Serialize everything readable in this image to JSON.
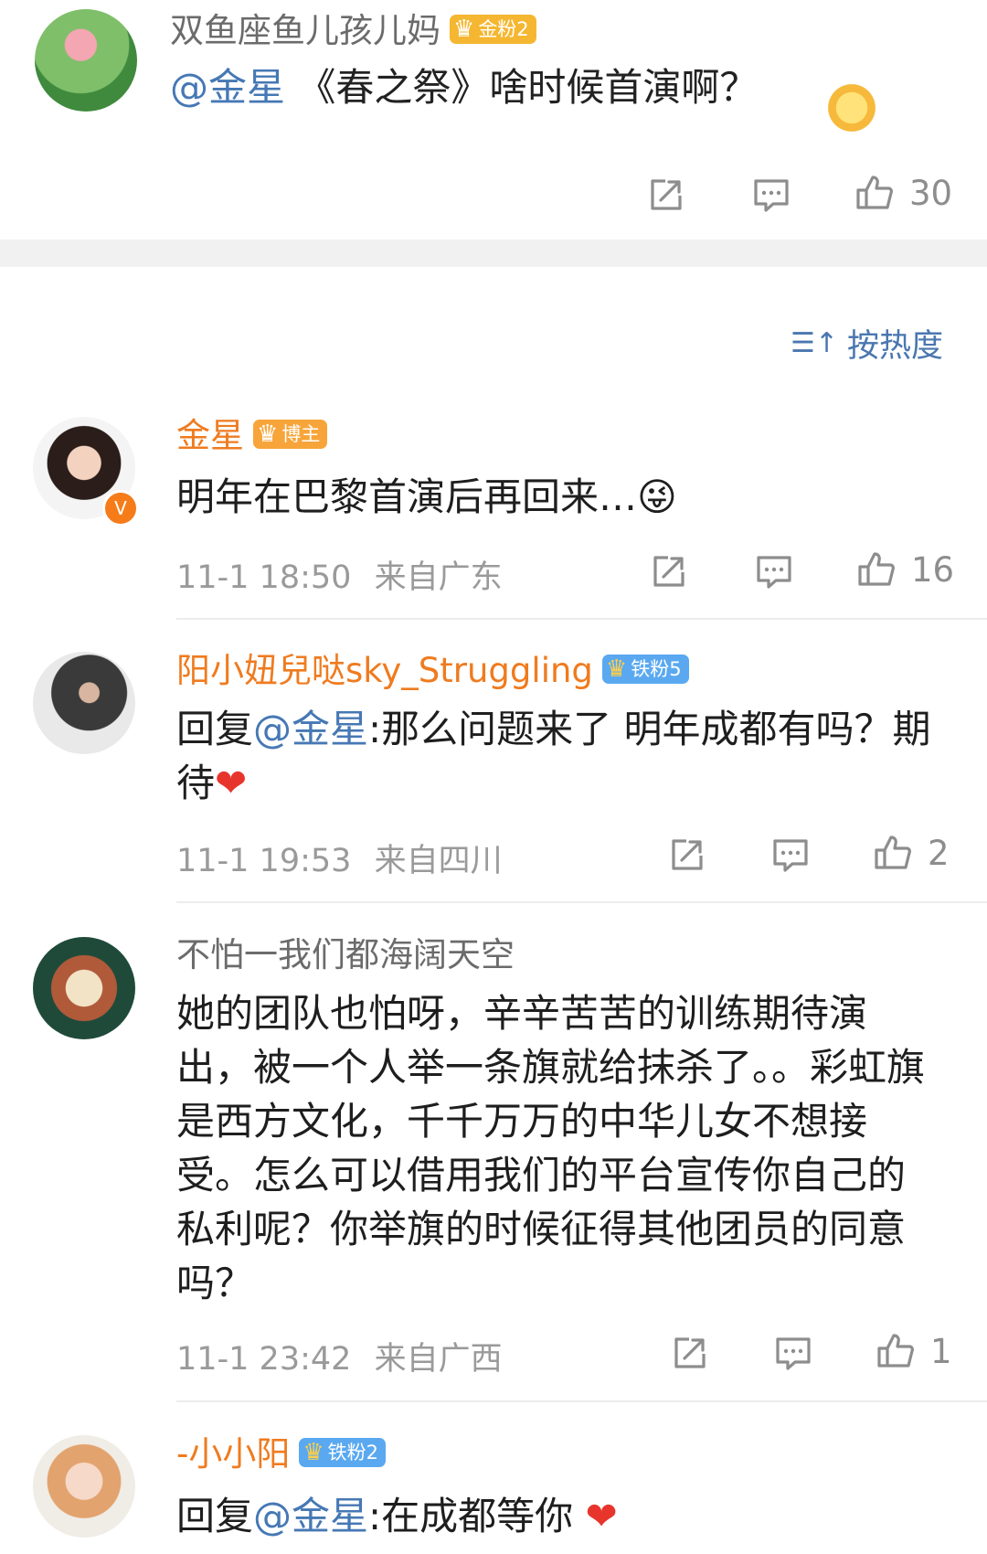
{
  "post": {
    "author": "双鱼座鱼儿孩儿妈",
    "badge": "金粉2",
    "mention": "@金星",
    "text": " 《春之祭》啥时候首演啊？",
    "likes": "30"
  },
  "sort": {
    "label": "按热度"
  },
  "comments": [
    {
      "name": "金星",
      "badge": "博主",
      "text": "明年在巴黎首演后再回来…",
      "emoji": "😜",
      "time": "11-1 18:50",
      "location": "来自广东",
      "likes": "16"
    },
    {
      "name": "阳小妞兒哒sky_Struggling",
      "badge": "铁粉5",
      "prefix": "回复",
      "mention": "@金星",
      "text": ":那么问题来了 明年成都有吗？期待",
      "emoji": "❤",
      "time": "11-1 19:53",
      "location": "来自四川",
      "likes": "2"
    },
    {
      "name": "不怕一我们都海阔天空",
      "text": "她的团队也怕呀，辛辛苦苦的训练期待演出，被一个人举一条旗就给抹杀了。。彩虹旗是西方文化，千千万万的中华儿女不想接受。怎么可以借用我们的平台宣传你自己的私利呢？你举旗的时候征得其他团员的同意吗？",
      "time": "11-1 23:42",
      "location": "来自广西",
      "likes": "1"
    },
    {
      "name": "-小小阳",
      "badge": "铁粉2",
      "prefix": "回复",
      "mention": "@金星",
      "text": ":在成都等你 ",
      "emoji": "❤"
    }
  ],
  "icons": [
    "repost-icon",
    "comment-icon",
    "like-icon",
    "sort-icon",
    "crown-icon",
    "verified-icon"
  ],
  "colors": {
    "mention": "#4678b4",
    "orange_name": "#ef7b1f",
    "meta_gray": "#9a9a9a",
    "separator": "#f1f1f1"
  }
}
